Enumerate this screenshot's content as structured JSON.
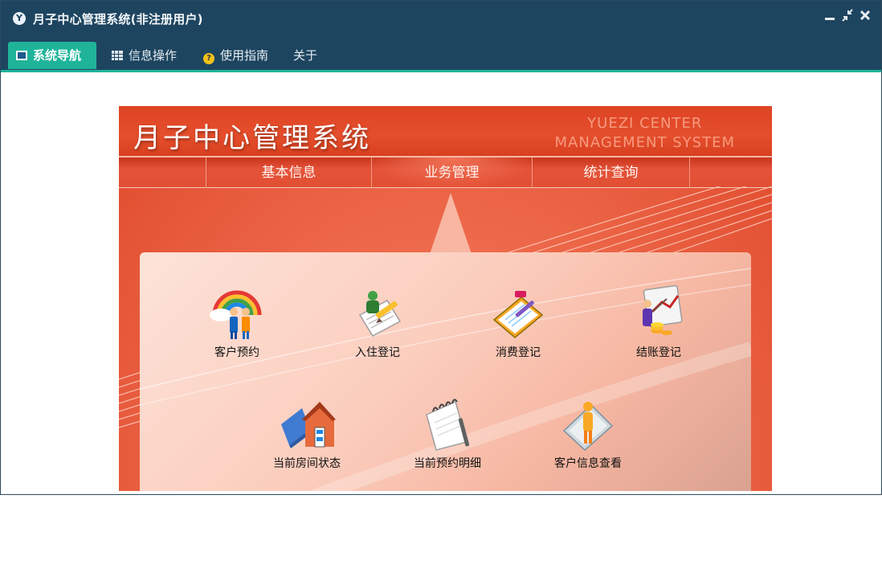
{
  "window": {
    "title": "月子中心管理系统(非注册用户)",
    "app_icon_glyph": "Y",
    "controls": {
      "minimize": "—",
      "restore": "✕",
      "close": "✖"
    }
  },
  "menu": {
    "items": [
      {
        "label": "系统导航",
        "icon": "monitor-icon",
        "active": true
      },
      {
        "label": "信息操作",
        "icon": "grid-icon"
      },
      {
        "label": "使用指南",
        "icon": "help-icon"
      },
      {
        "label": "关于"
      }
    ]
  },
  "banner": {
    "title": "月子中心管理系统",
    "subtitle_line1": "YUEZI CENTER",
    "subtitle_line2": "MANAGEMENT SYSTEM",
    "tabs": [
      "基本信息",
      "业务管理",
      "统计查询"
    ],
    "active_tab": "业务管理"
  },
  "tiles": [
    {
      "label": "客户预约",
      "icon": "customer-booking-icon"
    },
    {
      "label": "入住登记",
      "icon": "checkin-register-icon"
    },
    {
      "label": "消费登记",
      "icon": "consumption-register-icon"
    },
    {
      "label": "结账登记",
      "icon": "checkout-register-icon"
    },
    {
      "label": "当前房间状态",
      "icon": "room-status-icon"
    },
    {
      "label": "当前预约明细",
      "icon": "booking-detail-icon"
    },
    {
      "label": "客户信息查看",
      "icon": "customer-info-icon"
    }
  ],
  "colors": {
    "titlebar": "#1e4560",
    "accent": "#1fb49a",
    "banner": "#e04a2c"
  }
}
